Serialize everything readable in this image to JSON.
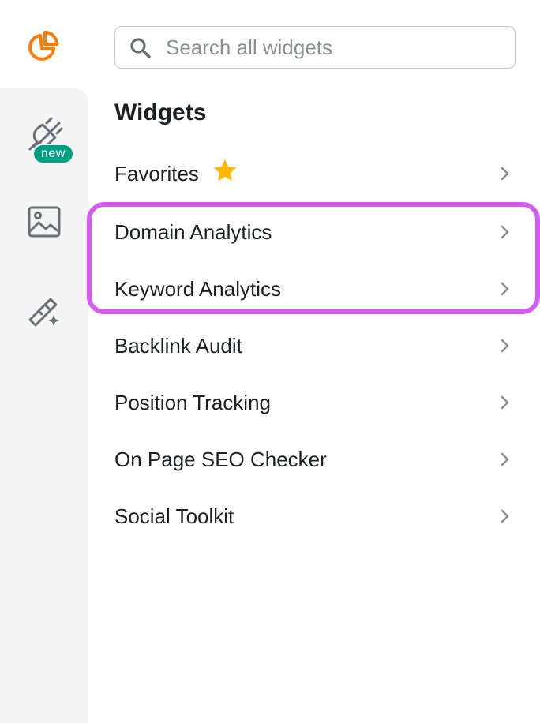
{
  "search": {
    "placeholder": "Search all widgets",
    "value": ""
  },
  "rail": {
    "new_badge": "new",
    "icons": [
      "pie-chart-logo-icon",
      "plug-icon",
      "image-icon",
      "magic-wand-icon"
    ]
  },
  "widgets": {
    "heading": "Widgets",
    "items": [
      {
        "label": "Favorites",
        "icon": "star-icon"
      },
      {
        "label": "Domain Analytics"
      },
      {
        "label": "Keyword Analytics"
      },
      {
        "label": "Backlink Audit"
      },
      {
        "label": "Position Tracking"
      },
      {
        "label": "On Page SEO Checker"
      },
      {
        "label": "Social Toolkit"
      }
    ]
  },
  "colors": {
    "brand_orange": "#ff7a00",
    "badge_green": "#009f81",
    "highlight_magenta": "#d45cf0",
    "star_yellow": "#ffb800",
    "rail_bg": "#f4f4f4"
  }
}
